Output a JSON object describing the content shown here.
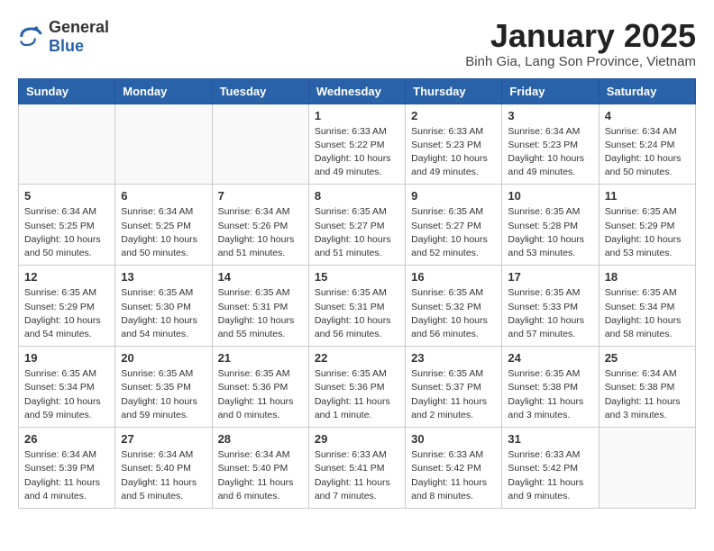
{
  "header": {
    "logo_general": "General",
    "logo_blue": "Blue",
    "month_title": "January 2025",
    "subtitle": "Binh Gia, Lang Son Province, Vietnam"
  },
  "weekdays": [
    "Sunday",
    "Monday",
    "Tuesday",
    "Wednesday",
    "Thursday",
    "Friday",
    "Saturday"
  ],
  "weeks": [
    [
      {
        "day": "",
        "info": ""
      },
      {
        "day": "",
        "info": ""
      },
      {
        "day": "",
        "info": ""
      },
      {
        "day": "1",
        "info": "Sunrise: 6:33 AM\nSunset: 5:22 PM\nDaylight: 10 hours\nand 49 minutes."
      },
      {
        "day": "2",
        "info": "Sunrise: 6:33 AM\nSunset: 5:23 PM\nDaylight: 10 hours\nand 49 minutes."
      },
      {
        "day": "3",
        "info": "Sunrise: 6:34 AM\nSunset: 5:23 PM\nDaylight: 10 hours\nand 49 minutes."
      },
      {
        "day": "4",
        "info": "Sunrise: 6:34 AM\nSunset: 5:24 PM\nDaylight: 10 hours\nand 50 minutes."
      }
    ],
    [
      {
        "day": "5",
        "info": "Sunrise: 6:34 AM\nSunset: 5:25 PM\nDaylight: 10 hours\nand 50 minutes."
      },
      {
        "day": "6",
        "info": "Sunrise: 6:34 AM\nSunset: 5:25 PM\nDaylight: 10 hours\nand 50 minutes."
      },
      {
        "day": "7",
        "info": "Sunrise: 6:34 AM\nSunset: 5:26 PM\nDaylight: 10 hours\nand 51 minutes."
      },
      {
        "day": "8",
        "info": "Sunrise: 6:35 AM\nSunset: 5:27 PM\nDaylight: 10 hours\nand 51 minutes."
      },
      {
        "day": "9",
        "info": "Sunrise: 6:35 AM\nSunset: 5:27 PM\nDaylight: 10 hours\nand 52 minutes."
      },
      {
        "day": "10",
        "info": "Sunrise: 6:35 AM\nSunset: 5:28 PM\nDaylight: 10 hours\nand 53 minutes."
      },
      {
        "day": "11",
        "info": "Sunrise: 6:35 AM\nSunset: 5:29 PM\nDaylight: 10 hours\nand 53 minutes."
      }
    ],
    [
      {
        "day": "12",
        "info": "Sunrise: 6:35 AM\nSunset: 5:29 PM\nDaylight: 10 hours\nand 54 minutes."
      },
      {
        "day": "13",
        "info": "Sunrise: 6:35 AM\nSunset: 5:30 PM\nDaylight: 10 hours\nand 54 minutes."
      },
      {
        "day": "14",
        "info": "Sunrise: 6:35 AM\nSunset: 5:31 PM\nDaylight: 10 hours\nand 55 minutes."
      },
      {
        "day": "15",
        "info": "Sunrise: 6:35 AM\nSunset: 5:31 PM\nDaylight: 10 hours\nand 56 minutes."
      },
      {
        "day": "16",
        "info": "Sunrise: 6:35 AM\nSunset: 5:32 PM\nDaylight: 10 hours\nand 56 minutes."
      },
      {
        "day": "17",
        "info": "Sunrise: 6:35 AM\nSunset: 5:33 PM\nDaylight: 10 hours\nand 57 minutes."
      },
      {
        "day": "18",
        "info": "Sunrise: 6:35 AM\nSunset: 5:34 PM\nDaylight: 10 hours\nand 58 minutes."
      }
    ],
    [
      {
        "day": "19",
        "info": "Sunrise: 6:35 AM\nSunset: 5:34 PM\nDaylight: 10 hours\nand 59 minutes."
      },
      {
        "day": "20",
        "info": "Sunrise: 6:35 AM\nSunset: 5:35 PM\nDaylight: 10 hours\nand 59 minutes."
      },
      {
        "day": "21",
        "info": "Sunrise: 6:35 AM\nSunset: 5:36 PM\nDaylight: 11 hours\nand 0 minutes."
      },
      {
        "day": "22",
        "info": "Sunrise: 6:35 AM\nSunset: 5:36 PM\nDaylight: 11 hours\nand 1 minute."
      },
      {
        "day": "23",
        "info": "Sunrise: 6:35 AM\nSunset: 5:37 PM\nDaylight: 11 hours\nand 2 minutes."
      },
      {
        "day": "24",
        "info": "Sunrise: 6:35 AM\nSunset: 5:38 PM\nDaylight: 11 hours\nand 3 minutes."
      },
      {
        "day": "25",
        "info": "Sunrise: 6:34 AM\nSunset: 5:38 PM\nDaylight: 11 hours\nand 3 minutes."
      }
    ],
    [
      {
        "day": "26",
        "info": "Sunrise: 6:34 AM\nSunset: 5:39 PM\nDaylight: 11 hours\nand 4 minutes."
      },
      {
        "day": "27",
        "info": "Sunrise: 6:34 AM\nSunset: 5:40 PM\nDaylight: 11 hours\nand 5 minutes."
      },
      {
        "day": "28",
        "info": "Sunrise: 6:34 AM\nSunset: 5:40 PM\nDaylight: 11 hours\nand 6 minutes."
      },
      {
        "day": "29",
        "info": "Sunrise: 6:33 AM\nSunset: 5:41 PM\nDaylight: 11 hours\nand 7 minutes."
      },
      {
        "day": "30",
        "info": "Sunrise: 6:33 AM\nSunset: 5:42 PM\nDaylight: 11 hours\nand 8 minutes."
      },
      {
        "day": "31",
        "info": "Sunrise: 6:33 AM\nSunset: 5:42 PM\nDaylight: 11 hours\nand 9 minutes."
      },
      {
        "day": "",
        "info": ""
      }
    ]
  ]
}
